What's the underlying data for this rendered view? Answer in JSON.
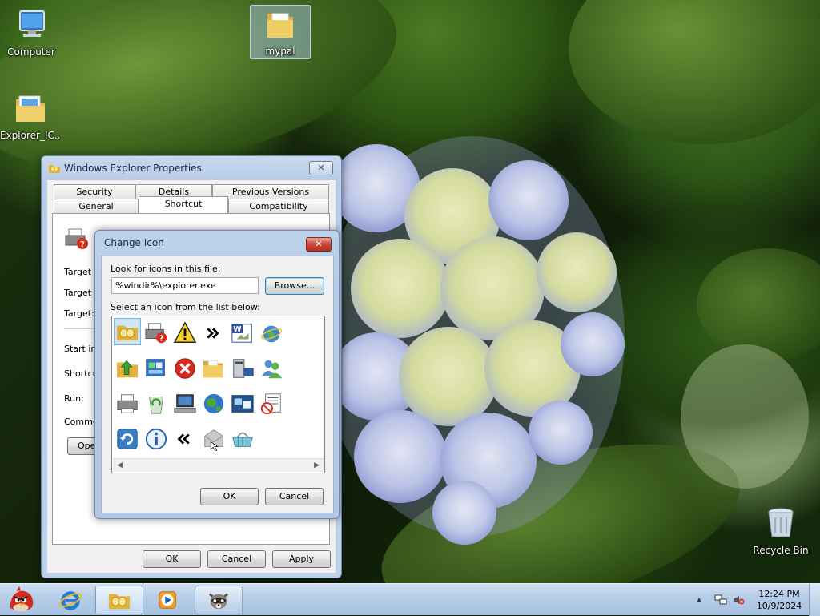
{
  "desktop": {
    "icons": [
      {
        "label": "Computer",
        "icon": "computer-icon"
      },
      {
        "label": "Explorer_IC...",
        "icon": "folder-image-icon"
      },
      {
        "label": "mypal",
        "icon": "folder-icon"
      },
      {
        "label": "Recycle Bin",
        "icon": "recycle-bin-icon"
      }
    ]
  },
  "properties_window": {
    "title": "Windows Explorer Properties",
    "close_label": "✕",
    "tabs_row1": [
      "Security",
      "Details",
      "Previous Versions"
    ],
    "tabs_row2": [
      "General",
      "Shortcut",
      "Compatibility"
    ],
    "active_tab": "Shortcut",
    "field_labels": [
      "Target ty",
      "Target lo",
      "Target:",
      "Start in:",
      "Shortcut",
      "Run:",
      "Commen"
    ],
    "open_button_partial": "Ope",
    "buttons": {
      "ok": "OK",
      "cancel": "Cancel",
      "apply": "Apply"
    }
  },
  "change_icon_dialog": {
    "title": "Change Icon",
    "close_label": "✕",
    "look_for_label": "Look for icons in this file:",
    "file_path": "%windir%\\explorer.exe",
    "browse_label": "Browse...",
    "select_label": "Select an icon from the list below:",
    "icons": [
      "explorer-folder-icon",
      "printer-help-icon",
      "warning-icon",
      "chevron-right-icon",
      "word-document-icon",
      "internet-globe-icon",
      "folder-up-icon",
      "control-panel-icon",
      "error-icon",
      "folder-icon",
      "server-icon",
      "users-icon",
      "printer-icon",
      "recycle-icon",
      "computer-icon",
      "globe-icon",
      "windows-icon",
      "blocked-document-icon",
      "refresh-icon",
      "info-icon",
      "chevron-left-icon",
      "envelope-icon",
      "basket-icon"
    ],
    "selected_index": 0,
    "buttons": {
      "ok": "OK",
      "cancel": "Cancel"
    }
  },
  "taskbar": {
    "items": [
      {
        "name": "start-button",
        "icon": "angry-bird-icon"
      },
      {
        "name": "taskbar-ie",
        "icon": "internet-explorer-icon"
      },
      {
        "name": "taskbar-explorer",
        "icon": "explorer-folder-icon"
      },
      {
        "name": "taskbar-media-player",
        "icon": "media-player-icon"
      },
      {
        "name": "taskbar-mypal",
        "icon": "raccoon-icon"
      }
    ],
    "tray_arrow": "▲",
    "clock_time": "12:24 PM",
    "clock_date": "10/9/2024"
  }
}
